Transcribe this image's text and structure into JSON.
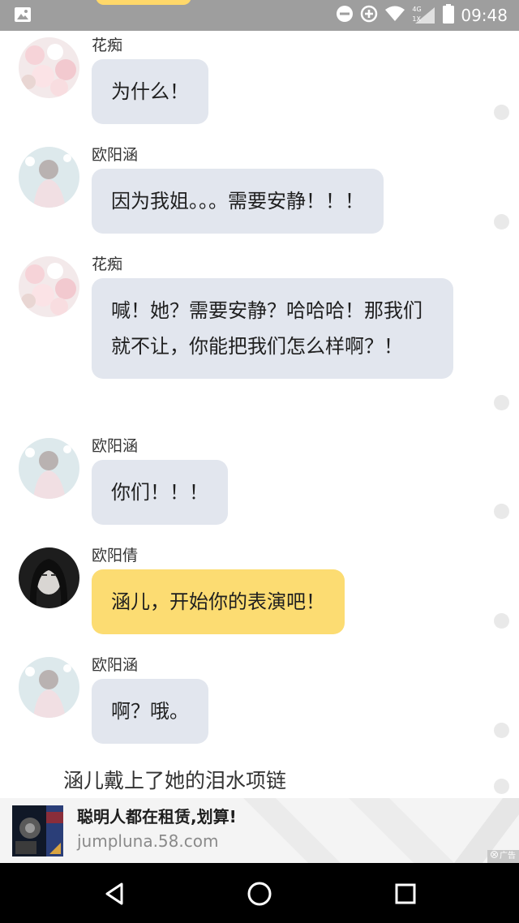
{
  "status_bar": {
    "time": "09:48",
    "network_label": "4G",
    "sim_label": "1X",
    "icons": [
      "image-notification-icon",
      "do-not-disturb-icon",
      "data-saver-icon",
      "wifi-icon",
      "cell-signal-icon",
      "battery-icon"
    ]
  },
  "messages": [
    {
      "sender": "花痴",
      "text": "为什么！",
      "style": "gray",
      "avatar": "flowers-avatar"
    },
    {
      "sender": "欧阳涵",
      "text": "因为我姐。。。需要安静！！！",
      "style": "gray",
      "avatar": "girl-light-avatar"
    },
    {
      "sender": "花痴",
      "text": "喊！她？需要安静？哈哈哈！那我们就不让，你能把我们怎么样啊？！",
      "style": "gray",
      "avatar": "flowers-avatar"
    },
    {
      "sender": "欧阳涵",
      "text": "你们！！！",
      "style": "gray",
      "avatar": "girl-light-avatar"
    },
    {
      "sender": "欧阳倩",
      "text": "涵儿，开始你的表演吧！",
      "style": "yellow",
      "avatar": "girl-dark-avatar"
    },
    {
      "sender": "欧阳涵",
      "text": "啊？哦。",
      "style": "gray",
      "avatar": "girl-light-avatar"
    }
  ],
  "narration": "涵儿戴上了她的泪水项链",
  "ad": {
    "title": "聪明人都在租赁,划算!",
    "url": "jumpluna.58.com",
    "badge": "广告"
  },
  "nav": {
    "icons": [
      "back-icon",
      "home-icon",
      "recents-icon"
    ]
  },
  "colors": {
    "status_bar": "#9e9e9e",
    "bubble_gray": "#e2e6ee",
    "bubble_yellow": "#fcdc72",
    "nav_bar": "#000000"
  }
}
